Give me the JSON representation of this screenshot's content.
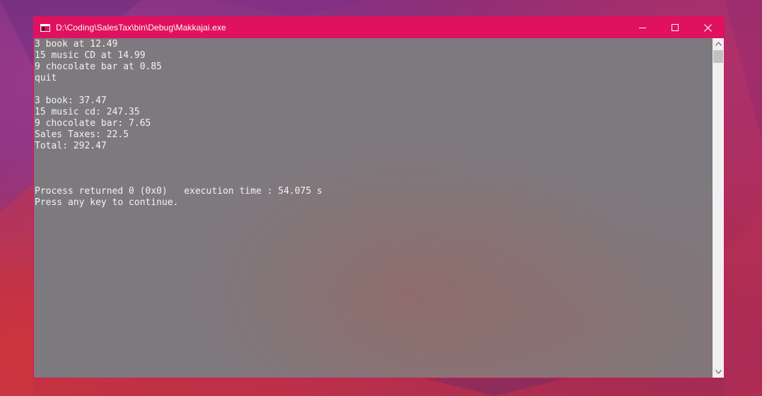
{
  "window": {
    "title": "D:\\Coding\\SalesTax\\bin\\Debug\\Makkajai.exe",
    "icon": "console-app-icon",
    "controls": {
      "minimize": "minimize-icon",
      "maximize": "maximize-icon",
      "close": "close-icon"
    }
  },
  "console": {
    "lines": [
      "3 book at 12.49",
      "15 music CD at 14.99",
      "9 chocolate bar at 0.85",
      "quit",
      "",
      "3 book: 37.47",
      "15 music cd: 247.35",
      "9 chocolate bar: 7.65",
      "Sales Taxes: 22.5",
      "Total: 292.47",
      "",
      "",
      "",
      "Process returned 0 (0x0)   execution time : 54.075 s",
      "Press any key to continue."
    ]
  },
  "scrollbar": {
    "up": "chevron-up-icon",
    "down": "chevron-down-icon"
  },
  "colors": {
    "titlebar": "#e0115e",
    "console_background": "#7d7a7f",
    "console_text": "#f2f2f2",
    "scrollbar_track": "#f0f0f0"
  }
}
